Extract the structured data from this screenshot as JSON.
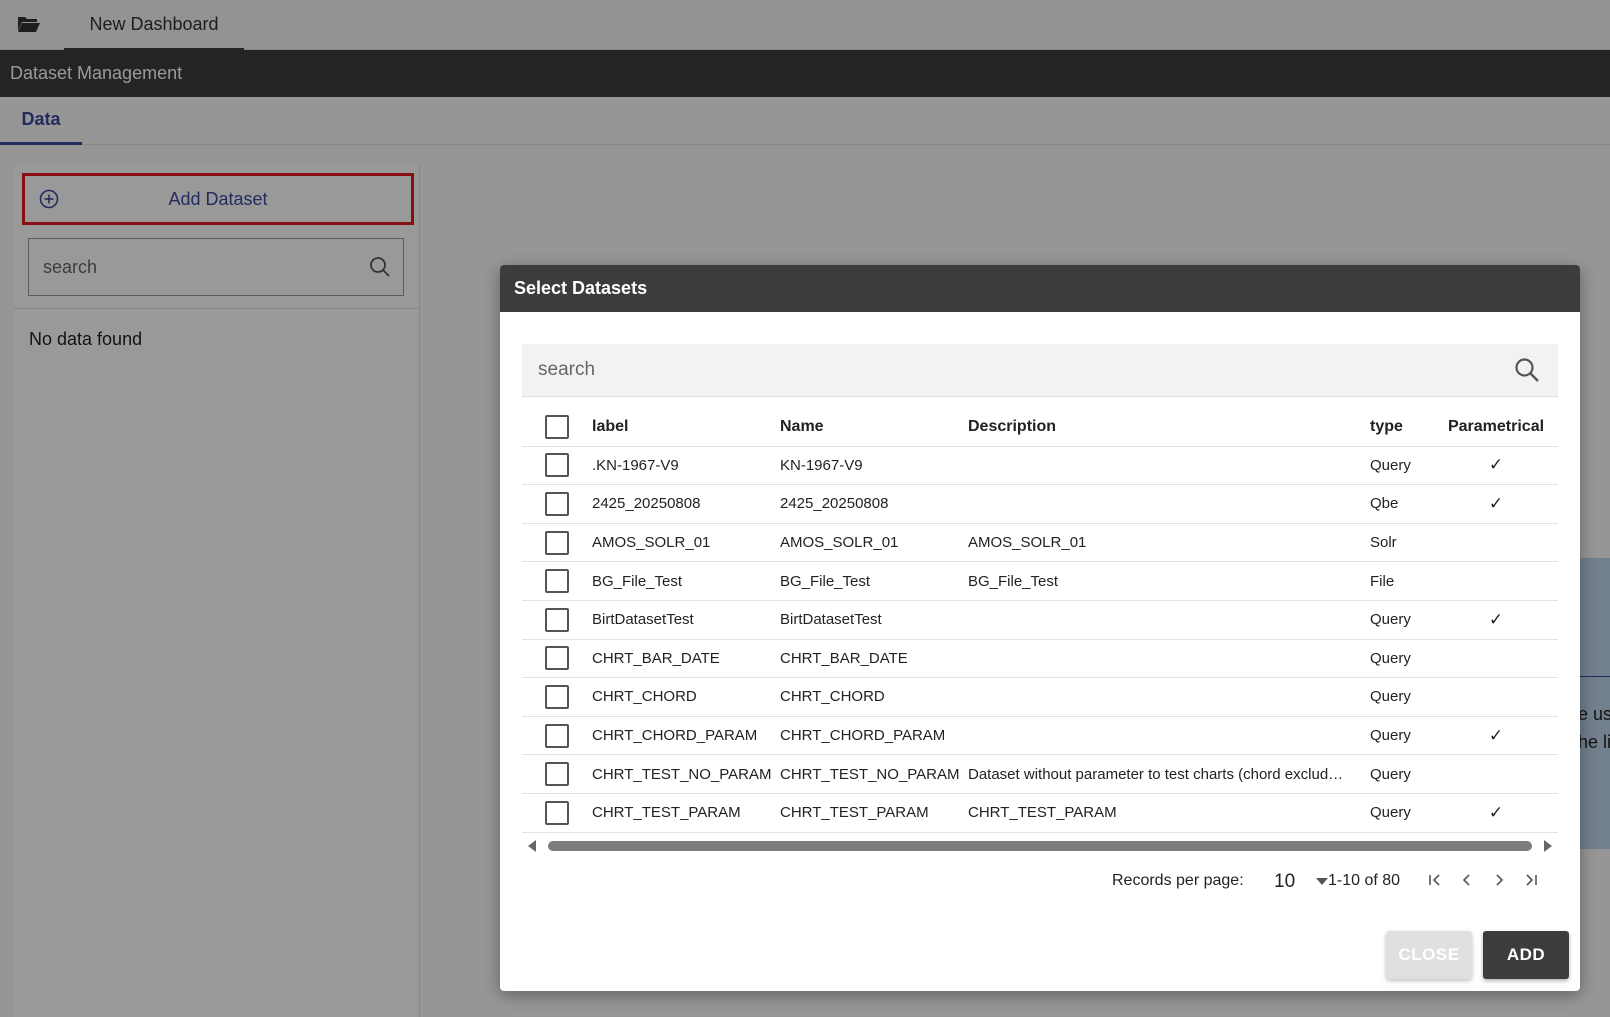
{
  "header": {
    "tab_title": "New Dashboard",
    "folder_icon": "folder-open-icon"
  },
  "titlebar": {
    "title": "Dataset Management"
  },
  "subtabs": [
    {
      "label": "Data"
    }
  ],
  "left_panel": {
    "add_label": "Add Dataset",
    "search_placeholder": "search",
    "empty_text": "No data found"
  },
  "background_panel": {
    "text_line1": "e use",
    "text_line2": "he lis"
  },
  "colors": {
    "accent": "#3b4a9c",
    "highlight_border": "#e31b23",
    "dark_bar": "#3c3c3c"
  },
  "modal": {
    "title": "Select Datasets",
    "search_placeholder": "search",
    "columns": {
      "label": "label",
      "name": "Name",
      "description": "Description",
      "type": "type",
      "parametrical": "Parametrical"
    },
    "rows": [
      {
        "label": ".KN-1967-V9",
        "name": "KN-1967-V9",
        "description": "",
        "type": "Query",
        "parametrical": true
      },
      {
        "label": "2425_20250808",
        "name": "2425_20250808",
        "description": "",
        "type": "Qbe",
        "parametrical": true
      },
      {
        "label": "AMOS_SOLR_01",
        "name": "AMOS_SOLR_01",
        "description": "AMOS_SOLR_01",
        "type": "Solr",
        "parametrical": false
      },
      {
        "label": "BG_File_Test",
        "name": "BG_File_Test",
        "description": "BG_File_Test",
        "type": "File",
        "parametrical": false
      },
      {
        "label": "BirtDatasetTest",
        "name": "BirtDatasetTest",
        "description": "",
        "type": "Query",
        "parametrical": true
      },
      {
        "label": "CHRT_BAR_DATE",
        "name": "CHRT_BAR_DATE",
        "description": "",
        "type": "Query",
        "parametrical": false
      },
      {
        "label": "CHRT_CHORD",
        "name": "CHRT_CHORD",
        "description": "",
        "type": "Query",
        "parametrical": false
      },
      {
        "label": "CHRT_CHORD_PARAM",
        "name": "CHRT_CHORD_PARAM",
        "description": "",
        "type": "Query",
        "parametrical": true
      },
      {
        "label": "CHRT_TEST_NO_PARAM",
        "name": "CHRT_TEST_NO_PARAM",
        "description": "Dataset without parameter to test charts (chord exclud…",
        "type": "Query",
        "parametrical": false
      },
      {
        "label": "CHRT_TEST_PARAM",
        "name": "CHRT_TEST_PARAM",
        "description": "CHRT_TEST_PARAM",
        "type": "Query",
        "parametrical": true
      }
    ],
    "check_glyph": "✓",
    "paginator": {
      "records_label": "Records per page:",
      "per_page": "10",
      "range": "1-10 of 80"
    },
    "buttons": {
      "close": "CLOSE",
      "add": "ADD"
    }
  }
}
